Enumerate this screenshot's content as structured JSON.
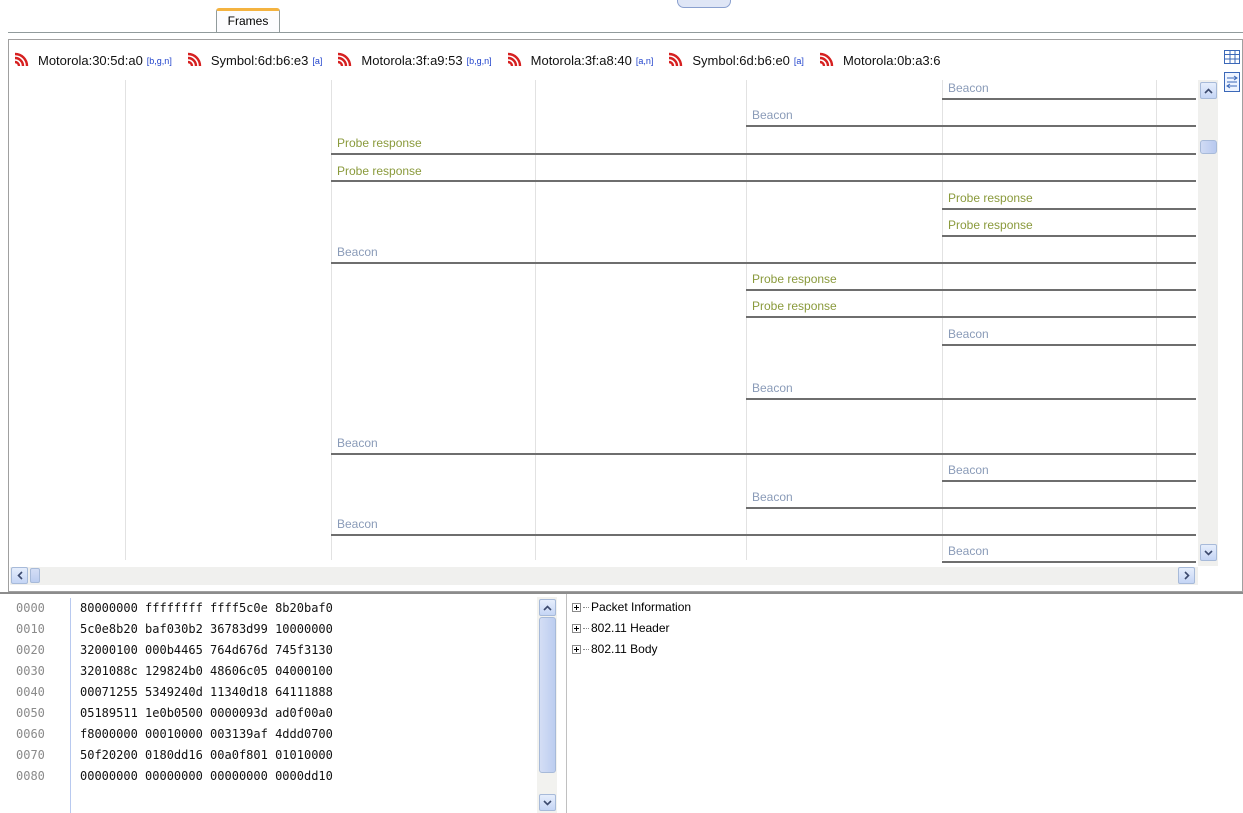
{
  "tabs": {
    "frames": "Frames"
  },
  "stations": [
    {
      "name": "Motorola:30:5d:a0",
      "band": "[b,g,n]"
    },
    {
      "name": "Symbol:6d:b6:e3",
      "band": "[a]"
    },
    {
      "name": "Motorola:3f:a9:53",
      "band": "[b,g,n]"
    },
    {
      "name": "Motorola:3f:a8:40",
      "band": "[a,n]"
    },
    {
      "name": "Symbol:6d:b6:e0",
      "band": "[a]"
    },
    {
      "name": "Motorola:0b:a3:6",
      "band": ""
    }
  ],
  "frames": [
    {
      "label": "Beacon",
      "type": "beacon"
    },
    {
      "label": "Beacon",
      "type": "beacon"
    },
    {
      "label": "Probe response",
      "type": "probe"
    },
    {
      "label": "Probe response",
      "type": "probe"
    },
    {
      "label": "Probe response",
      "type": "probe"
    },
    {
      "label": "Probe response",
      "type": "probe"
    },
    {
      "label": "Beacon",
      "type": "beacon"
    },
    {
      "label": "Probe response",
      "type": "probe"
    },
    {
      "label": "Probe response",
      "type": "probe"
    },
    {
      "label": "Beacon",
      "type": "beacon"
    },
    {
      "label": "Beacon",
      "type": "beacon"
    },
    {
      "label": "Beacon",
      "type": "beacon"
    },
    {
      "label": "Beacon",
      "type": "beacon"
    },
    {
      "label": "Beacon",
      "type": "beacon"
    },
    {
      "label": "Beacon",
      "type": "beacon"
    },
    {
      "label": "Beacon",
      "type": "beacon"
    }
  ],
  "colors": {
    "beacon": "#8a9bb8",
    "probe": "#8a9a3c",
    "wifi": "#d62020",
    "band": "#2244cc"
  },
  "hex": [
    {
      "offset": "0000",
      "data": "80000000 ffffffff ffff5c0e 8b20baf0"
    },
    {
      "offset": "0010",
      "data": "5c0e8b20 baf030b2 36783d99 10000000"
    },
    {
      "offset": "0020",
      "data": "32000100 000b4465 764d676d 745f3130"
    },
    {
      "offset": "0030",
      "data": "3201088c 129824b0 48606c05 04000100"
    },
    {
      "offset": "0040",
      "data": "00071255 5349240d 11340d18 64111888"
    },
    {
      "offset": "0050",
      "data": "05189511 1e0b0500 0000093d ad0f00a0"
    },
    {
      "offset": "0060",
      "data": "f8000000 00010000 003139af 4ddd0700"
    },
    {
      "offset": "0070",
      "data": "50f20200 0180dd16 00a0f801 01010000"
    },
    {
      "offset": "0080",
      "data": "00000000 00000000 00000000 0000dd10"
    }
  ],
  "tree": [
    {
      "label": "Packet Information"
    },
    {
      "label": "802.11 Header"
    },
    {
      "label": "802.11 Body"
    }
  ]
}
